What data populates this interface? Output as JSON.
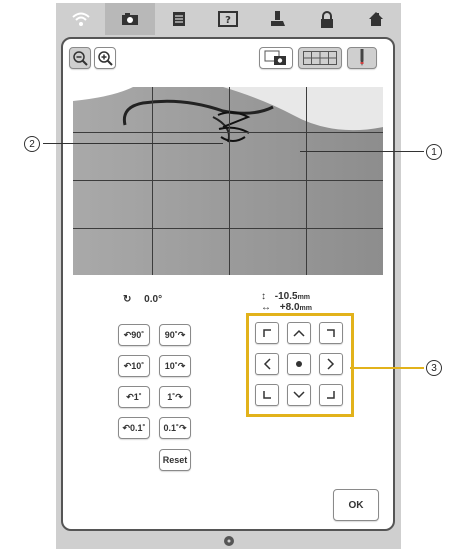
{
  "colors": {
    "accent": "#e2b21b",
    "frame": "#cfcfcf"
  },
  "topbar": {
    "icons": [
      "wifi-icon",
      "camera-icon",
      "document-icon",
      "help-icon",
      "presser-foot-icon",
      "lock-icon",
      "home-icon"
    ],
    "active": "camera-icon"
  },
  "toolbar": {
    "zoom_out_icon": "zoom-out-icon",
    "zoom_in_icon": "zoom-in-icon",
    "camera_view_icon": "camera-view-icon",
    "grid_icon": "grid-icon",
    "needle_icon": "needle-icon"
  },
  "readouts": {
    "rotation_value": "0.0°",
    "vertical_value": "-10.5",
    "horizontal_value": "+8.0",
    "unit": "mm"
  },
  "rotate_buttons": {
    "ccw_90": "90˚",
    "cw_90": "90˚",
    "ccw_10": "10˚",
    "cw_10": "10˚",
    "ccw_1": "1˚",
    "cw_1": "1˚",
    "ccw_01": "0.1˚",
    "cw_01": "0.1˚",
    "reset": "Reset"
  },
  "ok_label": "OK",
  "callouts": {
    "one": "1",
    "two": "2",
    "three": "3"
  }
}
